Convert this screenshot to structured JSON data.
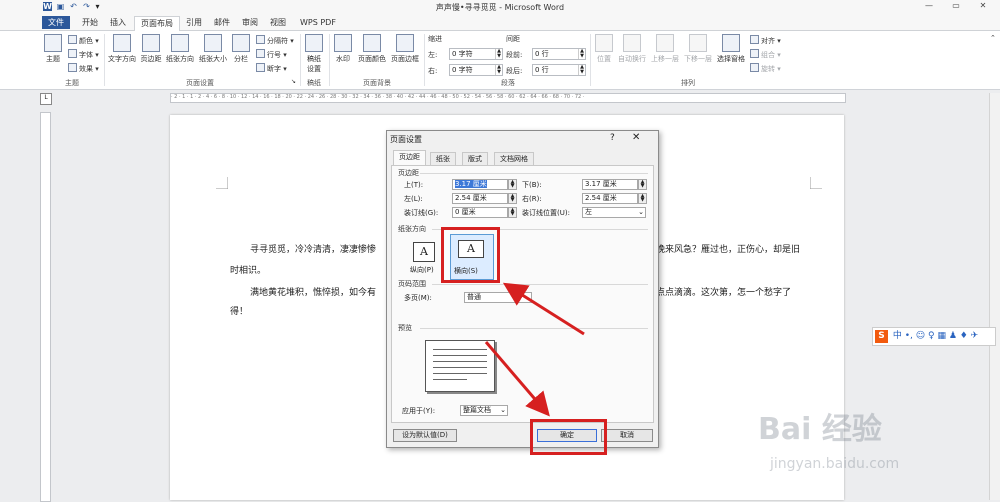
{
  "window": {
    "title": "声声慢•寻寻觅觅 - Microsoft Word",
    "minimize": "—",
    "restore": "▭",
    "close": "✕"
  },
  "quick_access": {
    "icons": [
      "word-logo-icon",
      "save-icon",
      "undo-icon",
      "redo-icon",
      "customize-icon"
    ]
  },
  "tabs": [
    "文件",
    "开始",
    "插入",
    "页面布局",
    "引用",
    "邮件",
    "审阅",
    "视图",
    "WPS PDF"
  ],
  "active_tab": "页面布局",
  "ribbon": {
    "theme_group": {
      "label": "主题",
      "theme": "主题",
      "colors": "颜色 ▾",
      "fonts": "字体 ▾",
      "effects": "效果 ▾"
    },
    "page_setup": {
      "label": "页面设置",
      "text_direction": "文字方向",
      "margins": "页边距",
      "orientation": "纸张方向",
      "size": "纸张大小",
      "columns": "分栏",
      "breaks": "分隔符 ▾",
      "line_numbers": "行号 ▾",
      "hyphenation": "断字 ▾"
    },
    "draft": {
      "label": "稿纸",
      "button": "稿纸\n设置"
    },
    "background": {
      "label": "页面背景",
      "watermark": "水印",
      "page_color": "页面颜色",
      "page_borders": "页面边框"
    },
    "paragraph": {
      "label": "段落",
      "indent": "缩进",
      "spacing": "间距",
      "left": "左:",
      "right": "右:",
      "left_val": "0 字符",
      "right_val": "0 字符",
      "before": "段前:",
      "after": "段后:",
      "before_val": "0 行",
      "after_val": "0 行"
    },
    "arrange": {
      "label": "排列",
      "position": "位置",
      "wrap": "自动换行",
      "forward": "上移一层",
      "backward": "下移一层",
      "selection": "选择窗格",
      "align": "对齐 ▾",
      "group": "组合 ▾",
      "rotate": "旋转 ▾"
    }
  },
  "document": {
    "p1_line1a": "寻寻觅觅，冷冷清清，凄凄惨惨",
    "p1_line1b": "晚来风急？雁过也，正伤心，却是旧",
    "p1_line2": "时相识。",
    "p2_line1a": "满地黄花堆积，憔悴损，如今有",
    "p2_line1b": "点点滴滴。这次第，怎一个愁字了",
    "p2_line2": "得！"
  },
  "dialog": {
    "title": "页面设置",
    "help": "?",
    "close": "✕",
    "tabs": [
      "页边距",
      "纸张",
      "版式",
      "文档网格"
    ],
    "margins_section": "页边距",
    "top_label": "上(T):",
    "top_value": "3.17 厘米",
    "bottom_label": "下(B):",
    "bottom_value": "3.17 厘米",
    "left_label": "左(L):",
    "left_value": "2.54 厘米",
    "right_label": "右(R):",
    "right_value": "2.54 厘米",
    "gutter_label": "装订线(G):",
    "gutter_value": "0 厘米",
    "gutter_pos_label": "装订线位置(U):",
    "gutter_pos_value": "左",
    "orientation_section": "纸张方向",
    "portrait_label": "纵向(P)",
    "landscape_label": "横向(S)",
    "pages_section": "页码范围",
    "multiple_pages_label": "多页(M):",
    "multiple_pages_value": "普通",
    "preview_section": "预览",
    "apply_to_label": "应用于(Y):",
    "apply_to_value": "整篇文档",
    "set_default": "设为默认值(D)",
    "ok": "确定",
    "cancel": "取消"
  },
  "ime_bar": {
    "logo": "S",
    "mode": "中 •, ☺ ♀ ▦ ♟ ♦ ✈"
  },
  "watermark": {
    "brand": "Bai 经验",
    "url": "jingyan.baidu.com"
  },
  "colors": {
    "accent": "#2b579a",
    "highlight": "#d62020"
  }
}
